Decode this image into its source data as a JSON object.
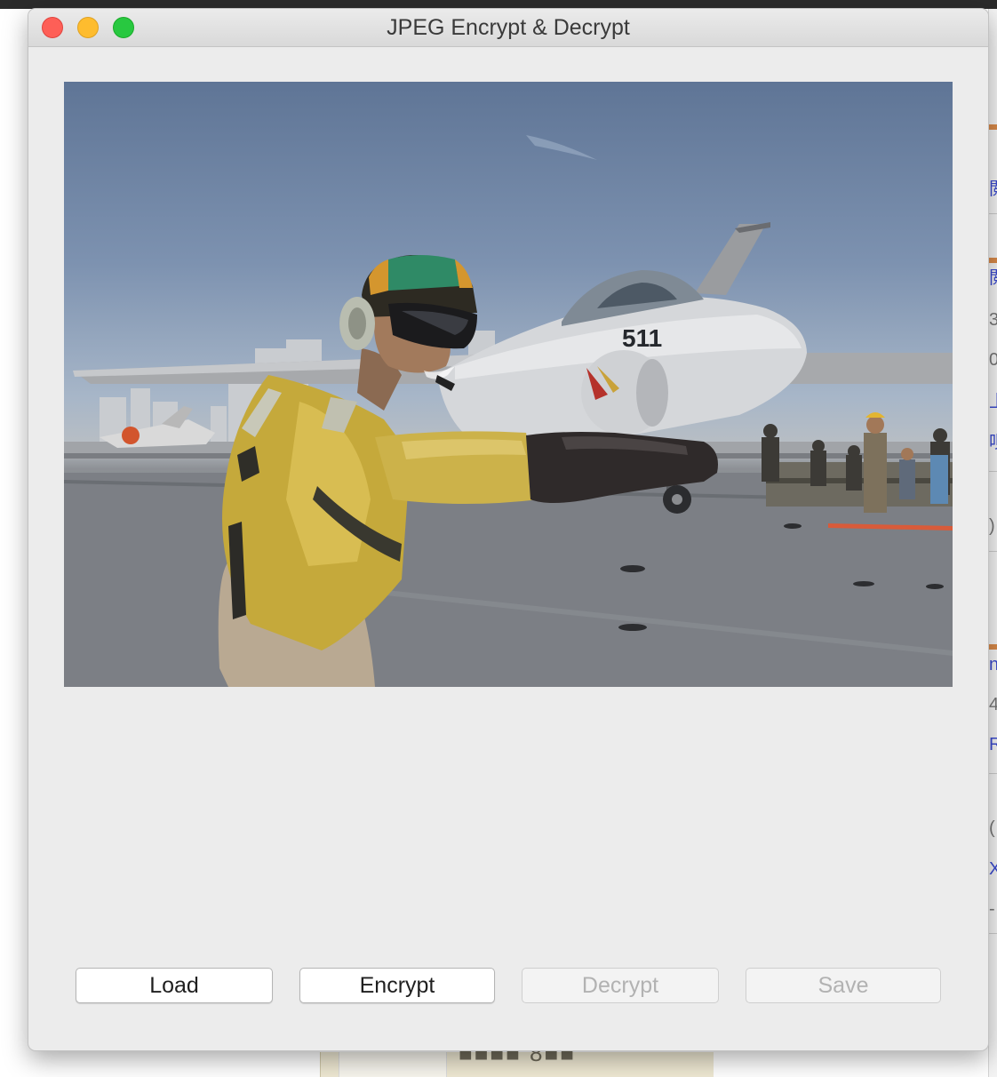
{
  "window": {
    "title": "JPEG Encrypt & Decrypt"
  },
  "buttons": {
    "load": "Load",
    "encrypt": "Encrypt",
    "decrypt": "Decrypt",
    "save": "Save"
  },
  "button_states": {
    "load_enabled": true,
    "encrypt_enabled": true,
    "decrypt_enabled": false,
    "save_enabled": false
  },
  "image": {
    "aircraft_marking": "511"
  },
  "colors": {
    "close": "#fe5f57",
    "minimize": "#febc2e",
    "maximize": "#28c840",
    "window_bg": "#ececec",
    "disabled_text": "#b2b2b2"
  }
}
